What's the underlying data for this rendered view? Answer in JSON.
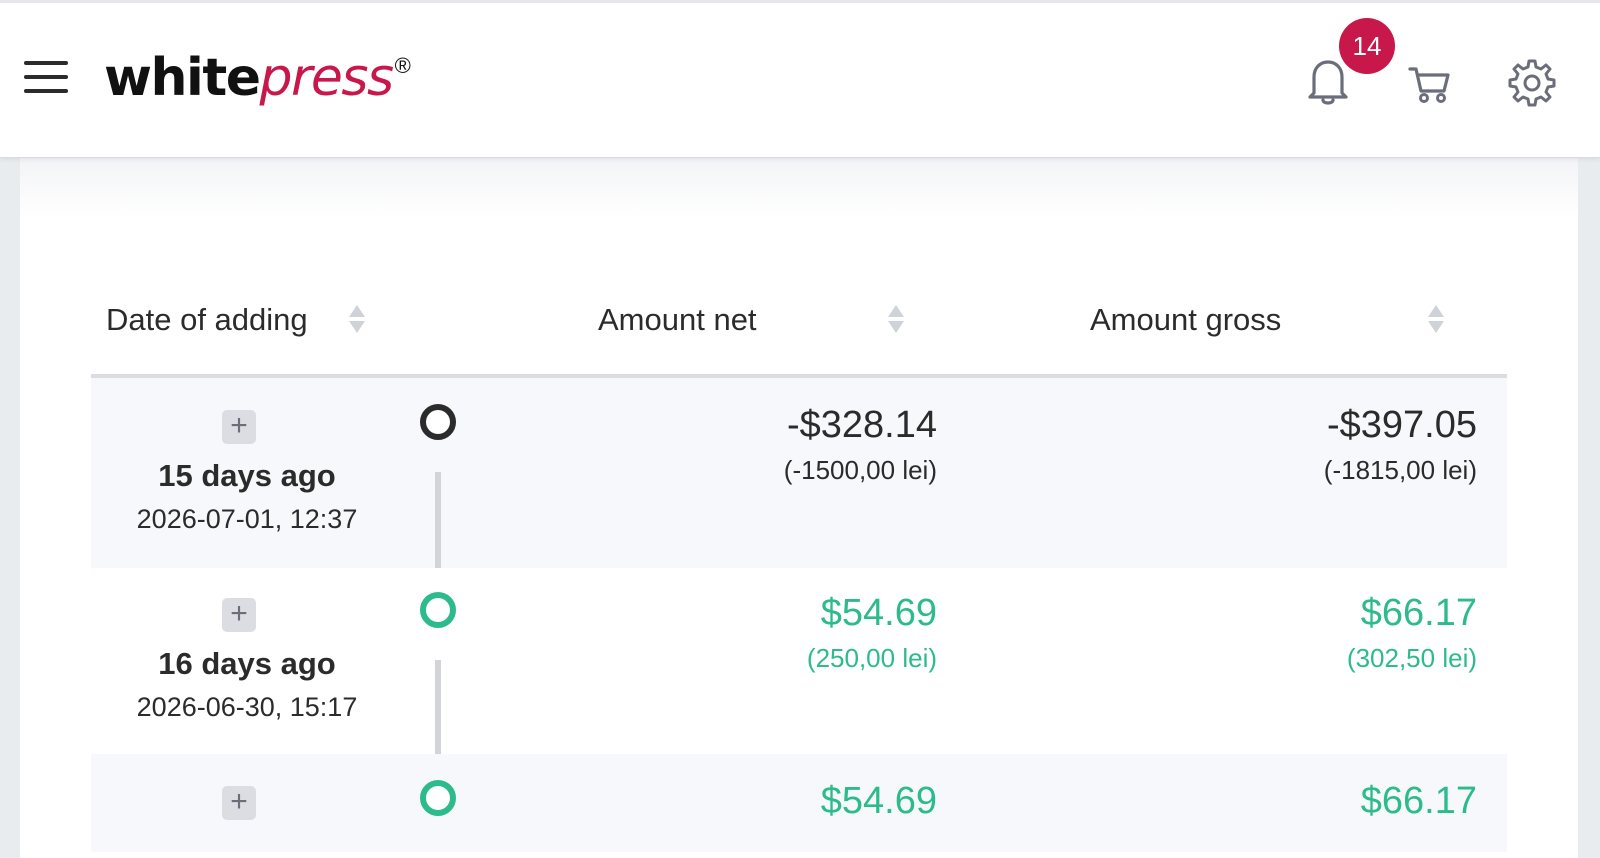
{
  "header": {
    "logo_white": "white",
    "logo_press": "press",
    "logo_reg": "®",
    "notifications_count": "14",
    "icons": [
      "menu-icon",
      "bell-icon",
      "cart-icon",
      "gear-icon"
    ],
    "brand_color": "#c8174a"
  },
  "table": {
    "columns": [
      {
        "label": "Date of adding"
      },
      {
        "label": "Amount net"
      },
      {
        "label": "Amount gross"
      }
    ],
    "rows": [
      {
        "relative": "15 days ago",
        "datetime": "2026-07-01, 12:37",
        "net": "-$328.14",
        "net_lei": "(-1500,00 lei)",
        "gross": "-$397.05",
        "gross_lei": "(-1815,00 lei)",
        "status": "negative"
      },
      {
        "relative": "16 days ago",
        "datetime": "2026-06-30, 15:17",
        "net": "$54.69",
        "net_lei": "(250,00 lei)",
        "gross": "$66.17",
        "gross_lei": "(302,50 lei)",
        "status": "positive"
      },
      {
        "relative": "",
        "datetime": "",
        "net": "$54.69",
        "net_lei": "",
        "gross": "$66.17",
        "gross_lei": "",
        "status": "positive"
      }
    ],
    "positive_color": "#2dbb8c",
    "negative_color": "#2b2b2b"
  }
}
